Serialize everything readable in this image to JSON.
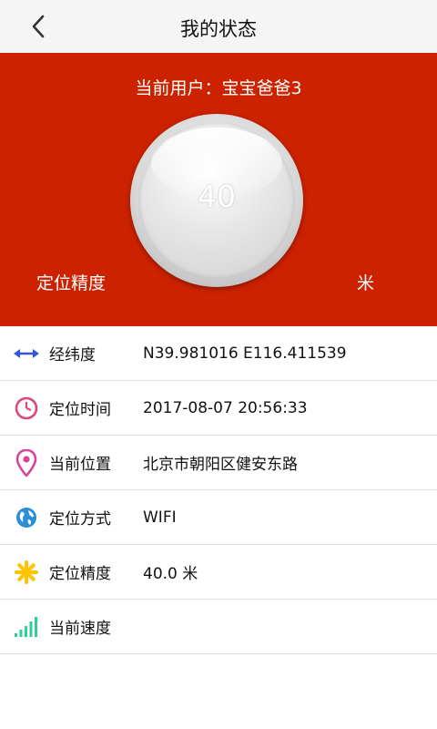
{
  "header": {
    "title": "我的状态",
    "back_icon": "back-arrow-icon"
  },
  "hero": {
    "background": "#cc2200",
    "user_label": "当前用户：宝宝爸爸3",
    "gauge_value": "40",
    "accuracy_label": "定位精度",
    "unit": "米"
  },
  "rows": [
    {
      "icon": "double-arrow-icon",
      "label": "经纬度",
      "value": "N39.981016  E116.411539"
    },
    {
      "icon": "clock-icon",
      "label": "定位时间",
      "value": "2017-08-07 20:56:33"
    },
    {
      "icon": "location-pin-icon",
      "label": "当前位置",
      "value": "北京市朝阳区健安东路"
    },
    {
      "icon": "globe-icon",
      "label": "定位方式",
      "value": "WIFI"
    },
    {
      "icon": "sun-icon",
      "label": "定位精度",
      "value": "40.0 米"
    },
    {
      "icon": "signal-bars-icon",
      "label": "当前速度",
      "value": ""
    }
  ],
  "colors": {
    "arrow": "#3355dd",
    "clock": "#e0457b",
    "pin": "#d9449a",
    "globe": "#2a8fd8",
    "sun": "#ffc400",
    "signal": "#2fcf9a"
  }
}
